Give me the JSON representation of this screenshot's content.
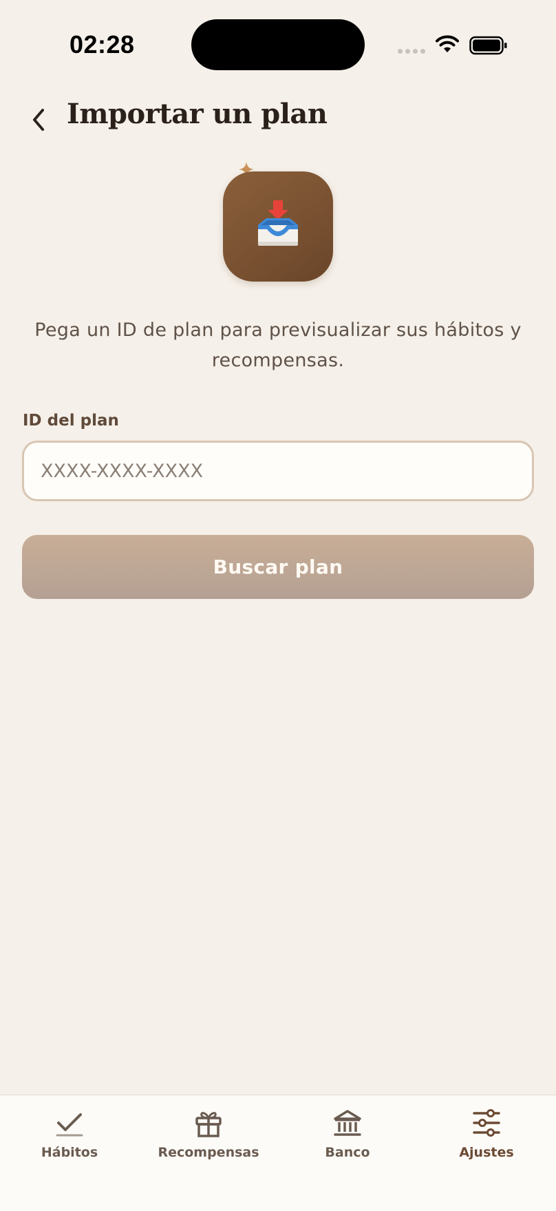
{
  "status_bar": {
    "time": "02:28"
  },
  "header": {
    "title": "Importar un plan",
    "back_icon": "chevron-left-icon"
  },
  "hero": {
    "icon": "inbox-tray-icon",
    "accent_icon": "sparkle-icon"
  },
  "description": "Pega un ID de plan para previsualizar sus hábitos y recompensas.",
  "form": {
    "label": "ID del plan",
    "value": "",
    "placeholder": "XXXX-XXXX-XXXX",
    "button_label": "Buscar plan"
  },
  "tab_bar": {
    "active": "Ajustes",
    "items": [
      {
        "label": "Hábitos",
        "icon": "checkmark-icon"
      },
      {
        "label": "Recompensas",
        "icon": "gift-icon"
      },
      {
        "label": "Banco",
        "icon": "bank-icon"
      },
      {
        "label": "Ajustes",
        "icon": "sliders-icon"
      }
    ]
  },
  "colors": {
    "background": "#f5f0e9",
    "title": "#2b211b",
    "hero_tile": "#7a5232",
    "input_border": "#d8c5b2",
    "button": "#c0a794",
    "tab_bar": "#fdfbf7",
    "tab_active": "#6b4a33"
  }
}
